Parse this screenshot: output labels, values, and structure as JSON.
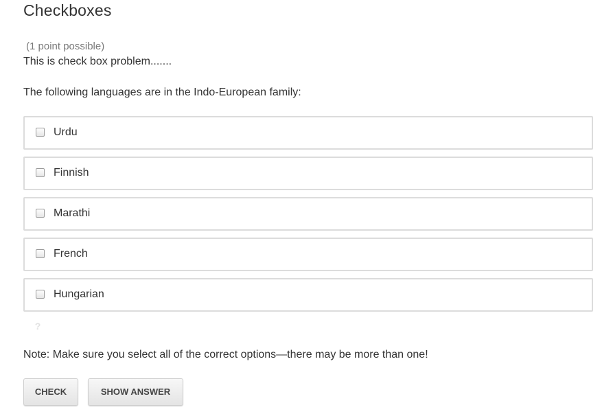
{
  "problem": {
    "title": "Checkboxes",
    "points": "(1 point possible)",
    "description": "This is check box problem.......",
    "question": "The following languages are in the Indo-European family:",
    "choices": [
      {
        "label": "Urdu",
        "checked": false
      },
      {
        "label": "Finnish",
        "checked": false
      },
      {
        "label": "Marathi",
        "checked": false
      },
      {
        "label": "French",
        "checked": false
      },
      {
        "label": "Hungarian",
        "checked": false
      }
    ],
    "help_icon": "?",
    "note": "Note: Make sure you select all of the correct options—there may be more than one!",
    "buttons": {
      "check": "CHECK",
      "show_answer": "SHOW ANSWER"
    }
  },
  "colors": {
    "text": "#333333",
    "muted": "#7a7a7a",
    "border": "#dcdcdc",
    "button_bg": "#eeeeee"
  }
}
